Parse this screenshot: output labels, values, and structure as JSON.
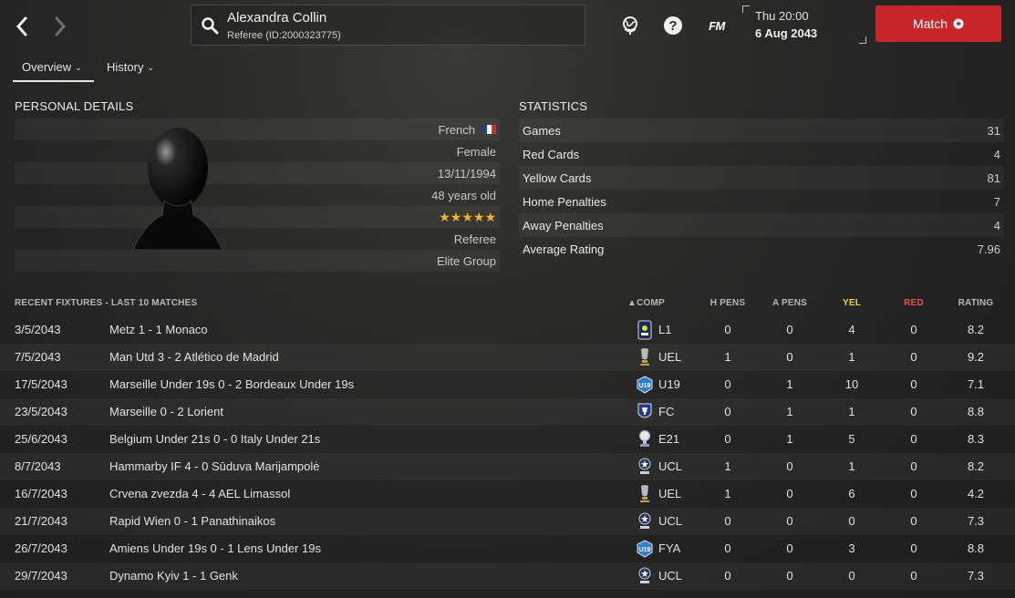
{
  "header": {
    "name": "Alexandra Collin",
    "subtitle": "Referee (ID:2000323775)",
    "time": "Thu 20:00",
    "date": "6 Aug 2043",
    "fm_label": "FM",
    "match_label": "Match"
  },
  "tabs": [
    {
      "label": "Overview"
    },
    {
      "label": "History"
    }
  ],
  "personal": {
    "title": "PERSONAL DETAILS",
    "nationality": "French",
    "gender": "Female",
    "dob": "13/11/1994",
    "age": "48 years old",
    "rating_stars": 5,
    "role": "Referee",
    "group": "Elite Group"
  },
  "statistics": {
    "title": "STATISTICS",
    "rows": [
      {
        "label": "Games",
        "value": "31"
      },
      {
        "label": "Red Cards",
        "value": "4"
      },
      {
        "label": "Yellow Cards",
        "value": "81"
      },
      {
        "label": "Home Penalties",
        "value": "7"
      },
      {
        "label": "Away Penalties",
        "value": "4"
      },
      {
        "label": "Average Rating",
        "value": "7.96"
      }
    ]
  },
  "fixtures": {
    "title": "RECENT FIXTURES - LAST 10 MATCHES",
    "columns": {
      "comp": "COMP",
      "h_pens": "H PENS",
      "a_pens": "A PENS",
      "yel": "YEL",
      "red": "RED",
      "rating": "RATING"
    },
    "colors": {
      "yel": "#f2d34a",
      "red": "#e05a5a",
      "accent": "#c8252b"
    },
    "rows": [
      {
        "date": "3/5/2043",
        "match": "Metz 1 - 1 Monaco",
        "comp": "L1",
        "icon": "ligue1-icon",
        "h": "0",
        "a": "0",
        "yel": "4",
        "red": "0",
        "rating": "8.2"
      },
      {
        "date": "7/5/2043",
        "match": "Man Utd 3 - 2 Atlético de Madrid",
        "comp": "UEL",
        "icon": "europa-league-icon",
        "h": "1",
        "a": "0",
        "yel": "1",
        "red": "0",
        "rating": "9.2"
      },
      {
        "date": "17/5/2043",
        "match": "Marseille Under 19s 0 - 2 Bordeaux Under 19s",
        "comp": "U19",
        "icon": "u19-icon",
        "h": "0",
        "a": "1",
        "yel": "10",
        "red": "0",
        "rating": "7.1"
      },
      {
        "date": "23/5/2043",
        "match": "Marseille 0 - 2 Lorient",
        "comp": "FC",
        "icon": "french-cup-icon",
        "h": "0",
        "a": "1",
        "yel": "1",
        "red": "0",
        "rating": "8.8"
      },
      {
        "date": "25/6/2043",
        "match": "Belgium Under 21s 0 - 0 Italy Under 21s",
        "comp": "E21",
        "icon": "euro-u21-icon",
        "h": "0",
        "a": "1",
        "yel": "5",
        "red": "0",
        "rating": "8.3"
      },
      {
        "date": "8/7/2043",
        "match": "Hammarby IF 4 - 0 Sūduva Marijampolė",
        "comp": "UCL",
        "icon": "champions-league-icon",
        "h": "1",
        "a": "0",
        "yel": "1",
        "red": "0",
        "rating": "8.2"
      },
      {
        "date": "16/7/2043",
        "match": "Crvena zvezda 4 - 4 AEL Limassol",
        "comp": "UEL",
        "icon": "europa-league-icon",
        "h": "1",
        "a": "0",
        "yel": "6",
        "red": "0",
        "rating": "4.2"
      },
      {
        "date": "21/7/2043",
        "match": "Rapid Wien 0 - 1 Panathinaikos",
        "comp": "UCL",
        "icon": "champions-league-icon",
        "h": "0",
        "a": "0",
        "yel": "0",
        "red": "0",
        "rating": "7.3"
      },
      {
        "date": "26/7/2043",
        "match": "Amiens Under 19s 0 - 1 Lens Under 19s",
        "comp": "FYA",
        "icon": "u19-icon",
        "h": "0",
        "a": "0",
        "yel": "3",
        "red": "0",
        "rating": "8.8"
      },
      {
        "date": "29/7/2043",
        "match": "Dynamo Kyiv 1 - 1 Genk",
        "comp": "UCL",
        "icon": "champions-league-icon",
        "h": "0",
        "a": "0",
        "yel": "0",
        "red": "0",
        "rating": "7.3"
      }
    ]
  }
}
